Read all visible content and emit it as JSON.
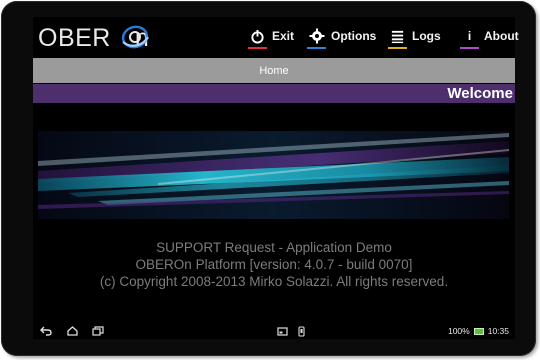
{
  "app": {
    "logo_text": "OBER",
    "logo_text_tail": "n"
  },
  "menu": {
    "exit": "Exit",
    "options": "Options",
    "logs": "Logs",
    "about": "About",
    "about_icon_glyph": "i"
  },
  "nav": {
    "home": "Home",
    "welcome": "Welcome"
  },
  "about_lines": [
    "SUPPORT Request - Application Demo",
    "OBEROn Platform [version: 4.0.7 - build 0070]",
    "(c) Copyright 2008-2013 Mirko Solazzi.  All rights reserved."
  ],
  "system_bar": {
    "battery": "100%",
    "time": "10:35"
  },
  "icons": {
    "exit": "power-icon",
    "options": "gear-icon",
    "logs": "list-icon",
    "about": "info-icon",
    "back": "back-icon",
    "home": "home-icon",
    "recent": "recent-apps-icon",
    "screenshot": "screenshot-icon",
    "device": "device-icon",
    "battery": "battery-icon"
  },
  "colors": {
    "homebar": "#9b9b9b",
    "welcomebar": "#4d2f6e",
    "text_gray": "#7c7c7c",
    "exit_accent": "#d33333",
    "options_accent": "#2f80d8",
    "logs_accent": "#e0b020",
    "about_accent": "#b04ac8"
  }
}
